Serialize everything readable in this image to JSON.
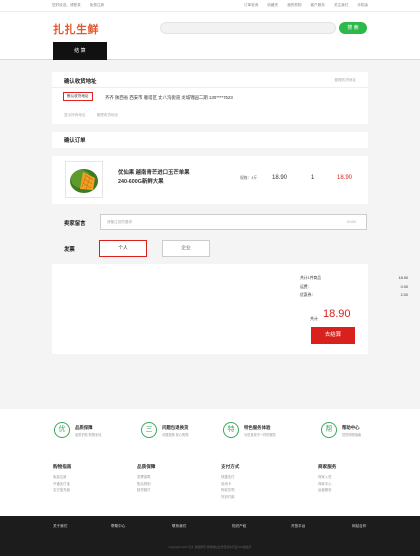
{
  "topbar": {
    "left": [
      "您好欢迎，请登录",
      "免费注册"
    ],
    "right": [
      "订单查询",
      "收藏夹",
      "我的购物",
      "客户服务",
      "关注我们",
      "手机版"
    ]
  },
  "header": {
    "logo": "扎扎生鲜",
    "search_placeholder": "",
    "search_button": "搜 索"
  },
  "steps": {
    "active": "结 算"
  },
  "address": {
    "title": "确认收货地址",
    "manage": "管理收货地址",
    "default_tag": "默认收货地址",
    "text": "齐齐 陕西省 西安市 雁塔区 丈八沟街道 龙城锦园二期   130****7523",
    "show_all": "显示所有地址",
    "manage_link": "管理收货地址"
  },
  "order": {
    "title": "确认订单",
    "item": {
      "name": "优仙果 越南青芒进口玉芒单果240-600G新鲜大果",
      "spec": "规格：4斤",
      "price": "18.90",
      "qty": "1",
      "subtotal": "18.90"
    }
  },
  "message": {
    "label": "卖家留言",
    "placeholder": "请备注您的要求",
    "count": "0/100"
  },
  "invoice": {
    "label": "发票",
    "options": [
      "个人",
      "企业"
    ],
    "selected": "个人"
  },
  "summary": {
    "rows": [
      {
        "label": "共计1件商品",
        "value": "18.90"
      },
      {
        "label": "运费：",
        "value": "0.00"
      },
      {
        "label": "优惠券：",
        "value": "2.00"
      }
    ],
    "total_label": "共计",
    "total": "18.90",
    "pay_button": "去结算"
  },
  "services": [
    {
      "icon": "优",
      "title": "品质保障",
      "desc": "品质护航 购物无忧"
    },
    {
      "icon": "三",
      "title": "问题包退换货",
      "desc": "问题退换 放心购物"
    },
    {
      "icon": "特",
      "title": "特色服务体验",
      "desc": "为您呈现不一样的服务"
    },
    {
      "icon": "帮",
      "title": "帮助中心",
      "desc": "您的购物指南"
    }
  ],
  "footer_links": [
    {
      "title": "购物指南",
      "items": [
        "免费注册",
        "开通支付宝",
        "支付宝充值"
      ]
    },
    {
      "title": "品质保障",
      "items": [
        "发票保障",
        "售后规则",
        "缺货赔付"
      ]
    },
    {
      "title": "支付方式",
      "items": [
        "快捷支付",
        "信用卡",
        "蚂蚁花呗",
        "货到付款"
      ]
    },
    {
      "title": "商家服务",
      "items": [
        "商家入驻",
        "商家中心",
        "运营服务"
      ]
    }
  ],
  "footer": {
    "nav": [
      "关于我们",
      "帮助中心",
      "联系我们",
      "知识产权",
      "开放平台",
      "网站合作"
    ],
    "copyright": "Copyright 2017 扎扎 版权所有 增值电信业务经营许可证 ICP备案号"
  },
  "colors": {
    "brand": "#e8572a",
    "accent": "#d8211d",
    "green": "#2db84a",
    "dark": "#1c1c1c"
  }
}
